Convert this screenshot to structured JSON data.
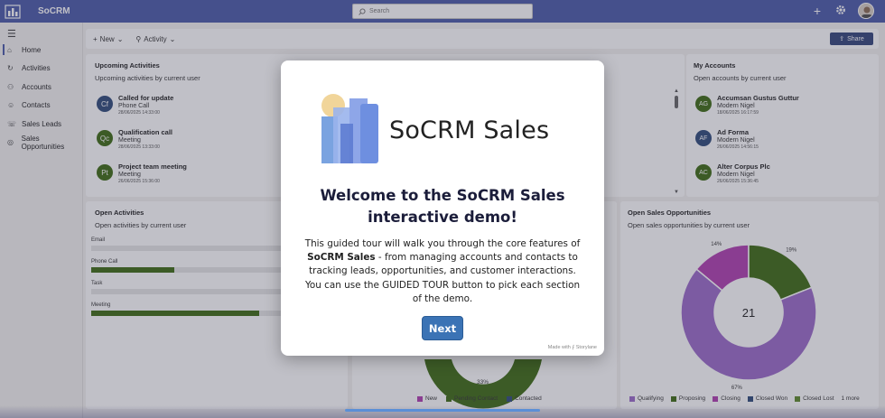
{
  "app": {
    "title": "SoCRM"
  },
  "search": {
    "placeholder": "Search"
  },
  "sidebar": {
    "items": [
      {
        "label": "Home",
        "icon": "home-icon"
      },
      {
        "label": "Activities",
        "icon": "activities-icon"
      },
      {
        "label": "Accounts",
        "icon": "accounts-icon"
      },
      {
        "label": "Contacts",
        "icon": "contacts-icon"
      },
      {
        "label": "Sales Leads",
        "icon": "leads-icon"
      },
      {
        "label": "Sales Opportunities",
        "icon": "opportunities-icon"
      }
    ]
  },
  "toolbar": {
    "new_label": "New",
    "activity_label": "Activity",
    "share_label": "Share"
  },
  "upcoming": {
    "title": "Upcoming Activities",
    "subtitle": "Upcoming activities by current user",
    "items": [
      {
        "initials": "Cf",
        "color": "#2f4a7a",
        "title": "Called for update",
        "type": "Phone Call",
        "date": "28/06/2025 14:33:00"
      },
      {
        "initials": "Qc",
        "color": "#3d6b12",
        "title": "Qualification call",
        "type": "Meeting",
        "date": "28/06/2025 13:33:00"
      },
      {
        "initials": "Pt",
        "color": "#3d6b12",
        "title": "Project team meeting",
        "type": "Meeting",
        "date": "26/06/2025 15:36:00"
      }
    ]
  },
  "accounts": {
    "title": "My Accounts",
    "subtitle": "Open accounts by current user",
    "items": [
      {
        "initials": "AG",
        "color": "#3d6b12",
        "title": "Accumsan Gustus Guttur",
        "owner": "Modern Nigel",
        "date": "18/06/2025 16:17:59"
      },
      {
        "initials": "AF",
        "color": "#2f4a7a",
        "title": "Ad Forma",
        "owner": "Modern Nigel",
        "date": "26/06/2025 14:56:15"
      },
      {
        "initials": "AC",
        "color": "#3d6b12",
        "title": "Alter Corpus Plc",
        "owner": "Modern Nigel",
        "date": "26/06/2025 15:36:45"
      }
    ]
  },
  "open_activities": {
    "title": "Open Activities",
    "subtitle": "Open activities by current user",
    "bars": [
      {
        "label": "Email",
        "value": 0.0
      },
      {
        "label": "Phone Call",
        "value": 0.33
      },
      {
        "label": "Task",
        "value": 0.0
      },
      {
        "label": "Meeting",
        "value": 0.67
      }
    ]
  },
  "leads_chart": {
    "label_33": "33%",
    "legend": [
      {
        "label": "New",
        "color": "#b03fb0"
      },
      {
        "label": "Pending Contact",
        "color": "#3d6b12"
      },
      {
        "label": "Contacted",
        "color": "#2f4a7a"
      }
    ]
  },
  "opportunities": {
    "title": "Open Sales Opportunities",
    "subtitle": "Open sales opportunities by current user",
    "total": "21",
    "labels": {
      "a": "14%",
      "b": "19%",
      "c": "67%"
    },
    "legend": [
      {
        "label": "Qualifying",
        "color": "#9b6bc9"
      },
      {
        "label": "Proposing",
        "color": "#3d6b12"
      },
      {
        "label": "Closing",
        "color": "#b03fb0"
      },
      {
        "label": "Closed Won",
        "color": "#2f4a7a"
      },
      {
        "label": "Closed Lost",
        "color": "#5d8a2a"
      }
    ],
    "more": "1 more"
  },
  "chart_data": {
    "type": "pie",
    "categories": [
      "Closing",
      "Proposing",
      "Qualifying"
    ],
    "values": [
      14,
      19,
      67
    ],
    "title": "Open Sales Opportunities",
    "xlabel": "",
    "ylabel": ""
  },
  "modal": {
    "brand": "SoCRM Sales",
    "heading_line1": "Welcome to the SoCRM Sales",
    "heading_line2": "interactive demo!",
    "body_pre": "This guided tour will walk you through the core features of",
    "body_bold": "SoCRM Sales",
    "body_post": "- from managing accounts and contacts to tracking leads, opportunities, and customer interactions. You can use the GUIDED TOUR button to pick each section of the demo.",
    "next_label": "Next",
    "made_with": "Made with ⨍ Storylane"
  },
  "colors": {
    "topbar": "#4a5aa8",
    "accent": "#3b73b5",
    "green": "#3d6b12",
    "purple": "#9b6bc9"
  }
}
